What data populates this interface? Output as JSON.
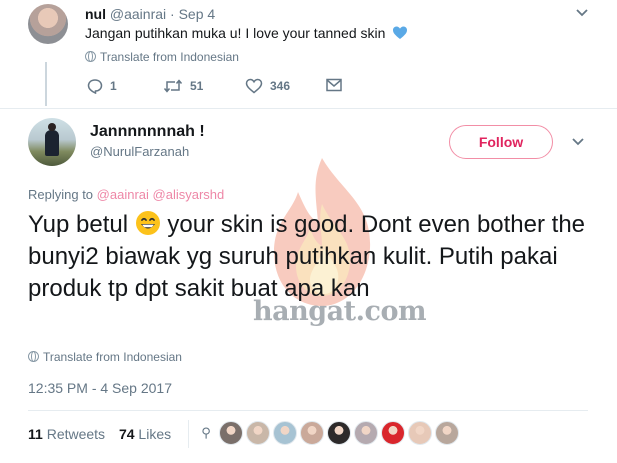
{
  "parent_tweet": {
    "name": "nul",
    "handle": "@aainrai",
    "separator": "·",
    "date": "Sep 4",
    "text": "Jangan putihkan muka u! I love your tanned skin",
    "translate": "Translate from Indonesian",
    "replies": "1",
    "retweets": "51",
    "likes": "346"
  },
  "main_tweet": {
    "name": "Jannnnnnnah !",
    "handle": "@NurulFarzanah",
    "follow_label": "Follow",
    "replying_prefix": "Replying to",
    "replying_to_1": "@aainrai",
    "replying_to_2": "@alisyarshd",
    "text_part1": "Yup betul",
    "text_part2": " your skin is good. Dont even bother the bunyi2 biawak yg suruh putihkan kulit. Putih pakai produk tp dpt sakit buat apa kan",
    "translate": "Translate from Indonesian",
    "timestamp": "12:35 PM - 4 Sep 2017",
    "retweet_count": "11",
    "retweet_label": "Retweets",
    "like_count": "74",
    "like_label": "Likes"
  },
  "watermark": {
    "text": "hangat.com"
  },
  "icons": {
    "reply": "reply-icon",
    "retweet": "retweet-icon",
    "like": "heart-icon",
    "dm": "envelope-icon",
    "translate": "globe-icon",
    "chevron": "chevron-down-icon"
  },
  "colors": {
    "accent_pink": "#e0245e",
    "muted": "#657786",
    "heart_emoji": "#5aa9e6"
  },
  "liker_colors": [
    "#7a6f6a",
    "#c9b7a8",
    "#a7c3d3",
    "#caa99a",
    "#2d2a2a",
    "#b5aab0",
    "#d9262c",
    "#e7c9b8",
    "#b8a79c"
  ]
}
